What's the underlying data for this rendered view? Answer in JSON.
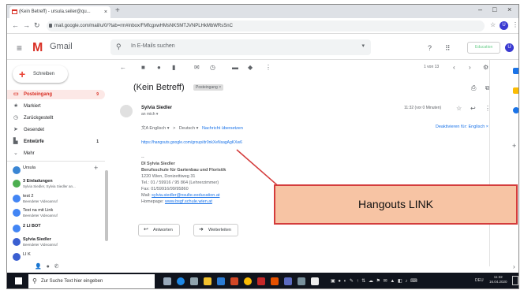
{
  "browser": {
    "tab_title": "(Kein Betreff) - ursula.seiler@qu...",
    "tab_close": "×",
    "new_tab": "+",
    "url": "mail.google.com/mail/u/0/?tab=rm#inbox/FMfcgxwHMsNKSMTJVNPLHkMbWRsSnC",
    "min": "–",
    "max": "□",
    "close": "×"
  },
  "gmail": {
    "brand": "Gmail",
    "search_placeholder": "In E-Mails suchen",
    "edu_chip": "Education",
    "profile_initial": "U"
  },
  "sidebar": {
    "compose": "Schreiben",
    "items": [
      {
        "label": "Posteingang",
        "count": "9",
        "icon": "inbox-icon"
      },
      {
        "label": "Markiert",
        "count": "",
        "icon": "star-icon"
      },
      {
        "label": "Zurückgestellt",
        "count": "",
        "icon": "clock-icon"
      },
      {
        "label": "Gesendet",
        "count": "",
        "icon": "send-icon"
      },
      {
        "label": "Entwürfe",
        "count": "1",
        "icon": "draft-icon"
      },
      {
        "label": "Mehr",
        "count": "",
        "icon": "chevron-down-icon"
      }
    ],
    "hangouts_user": "Ursula",
    "hangouts": [
      {
        "title": "3 Einladungen",
        "sub": "Sylvia Siedler, Sylvia Siedler an..."
      },
      {
        "title": "test 2",
        "sub": "Beendeter Videoanruf"
      },
      {
        "title": "Test na mit Link",
        "sub": "Beendeter Videoanruf"
      },
      {
        "title": "2 LI BOT",
        "sub": ""
      },
      {
        "title": "Sylvia Siedler",
        "sub": "Beendeter Videoanruf"
      },
      {
        "title": "LI K",
        "sub": ""
      }
    ]
  },
  "toolbar": {
    "pager": "1 von 13"
  },
  "message": {
    "subject": "(Kein Betreff)",
    "label": "Posteingang ×",
    "sender": "Sylvia Siedler",
    "to": "an mich ▾",
    "time": "11:32 (vor 0 Minuten)",
    "translate_from": "Englisch ▾",
    "translate_arrow": ">",
    "translate_to": "Deutsch ▾",
    "translate_action": "Nachricht übersetzen",
    "translate_disable": "Deaktivieren für: Englisch ×",
    "link": "https://hangouts.google.com/group/dr0nkXeNsagAgKXw6",
    "sig_dash": "--",
    "sig_name": "DI Sylvia Siedler",
    "sig_org": "Berufsschule für Gartenbau und Floristik",
    "sig_addr": "1220 Wien, Donizettiweg 31",
    "sig_tel": "Tel.: 01 / 59916 / 95 864 (Lehrerzimmer)",
    "sig_fax": "Fax: 01/59916/99/95860",
    "sig_mail_label": "Mail: ",
    "sig_mail": "sylvia.siedler@nsulte.eeducation.at",
    "sig_hp_label": "Homepage: ",
    "sig_hp": "www.bsgf.schule.wien.at",
    "reply": "Antworten",
    "forward": "Weiterleiten"
  },
  "taskbar": {
    "search": "Zur Suche Text hier eingeben",
    "lang": "DEU",
    "time": "11:32",
    "date": "16.04.2020"
  },
  "annotation": {
    "label": "Hangouts LINK",
    "box_color": "#f7c4a4",
    "border_color": "#d43c3c"
  }
}
